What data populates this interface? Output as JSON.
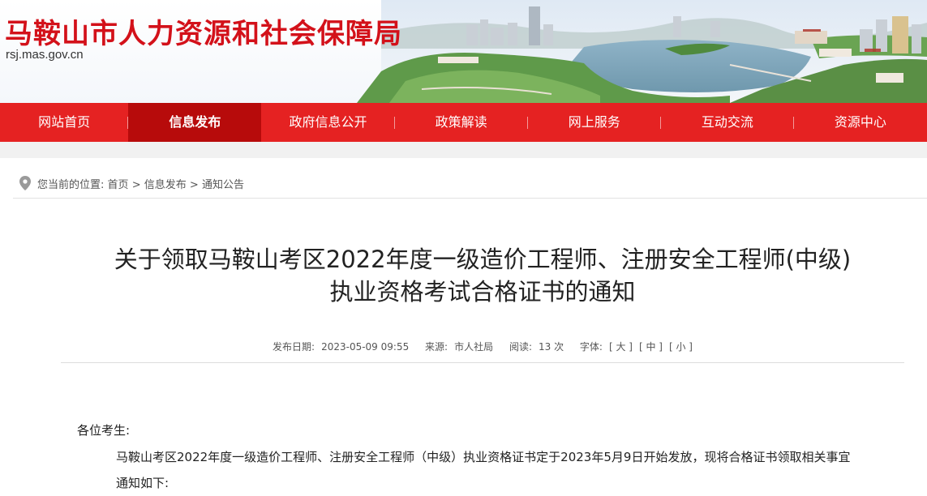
{
  "header": {
    "site_title": "马鞍山市人力资源和社会保障局",
    "site_url": "rsj.mas.gov.cn"
  },
  "nav": {
    "items": [
      "网站首页",
      "信息发布",
      "政府信息公开",
      "政策解读",
      "网上服务",
      "互动交流",
      "资源中心"
    ],
    "active": "信息发布"
  },
  "breadcrumb": {
    "prefix": "您当前的位置:",
    "home": "首页",
    "sep": ">",
    "level1": "信息发布",
    "level2": "通知公告"
  },
  "article": {
    "title_line1": "关于领取马鞍山考区2022年度一级造价工程师、注册安全工程师(中级)",
    "title_line2": "执业资格考试合格证书的通知",
    "meta": {
      "date_label": "发布日期:",
      "date": "2023-05-09 09:55",
      "source_label": "来源:",
      "source": "市人社局",
      "reads_label": "阅读:",
      "reads": "13 次",
      "font_label": "字体:",
      "font_large": "[ 大 ]",
      "font_medium": "[ 中 ]",
      "font_small": "[ 小 ]"
    },
    "salutation": "各位考生:",
    "paragraph": "马鞍山考区2022年度一级造价工程师、注册安全工程师（中级）执业资格证书定于2023年5月9日开始发放，现将合格证书领取相关事宜通知如下:"
  },
  "colors": {
    "brand_red": "#d3111a",
    "nav_red": "#e52222",
    "nav_active": "#b70b0b"
  }
}
